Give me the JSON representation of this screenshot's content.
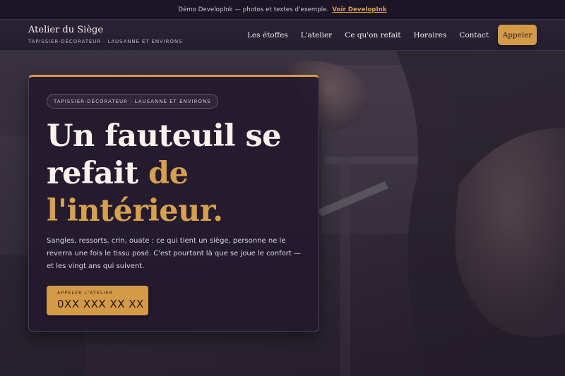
{
  "demo_bar": {
    "text": "Démo DevelopInk — photos et textes d'exemple.",
    "link": "Voir DevelopInk"
  },
  "header": {
    "brand_name": "Atelier du Siège",
    "tagline": "TAPISSIER-DÉCORATEUR · LAUSANNE ET ENVIRONS",
    "nav": [
      "Les étoffes",
      "L'atelier",
      "Ce qu'on refait",
      "Horaires",
      "Contact"
    ],
    "call_button": "Appeler"
  },
  "hero": {
    "pill": "TAPISSIER-DÉCORATEUR · LAUSANNE ET ENVIRONS",
    "headline_part1": "Un fauteuil se",
    "headline_part2": "refait ",
    "headline_accent1": "de",
    "headline_accent2": "l'intérieur.",
    "lede": "Sangles, ressorts, crin, ouate : ce qui tient un siège, personne ne le reverra une fois le tissu posé. C'est pourtant là que se joue le confort — et les vingt ans qui suivent.",
    "cta_label": "APPELER L'ATELIER",
    "cta_number": "0XX XXX XX XX"
  },
  "colors": {
    "accent": "#d39a48",
    "background": "#2a2132",
    "card": "#241a2e"
  }
}
